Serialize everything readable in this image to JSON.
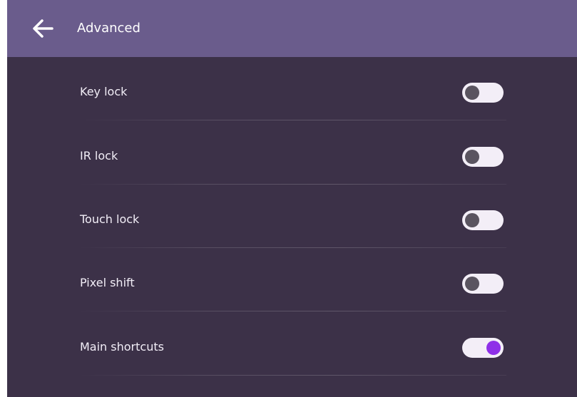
{
  "header": {
    "title": "Advanced",
    "back_icon": "arrow-left-icon"
  },
  "settings": [
    {
      "label": "Key lock",
      "enabled": false
    },
    {
      "label": "IR lock",
      "enabled": false
    },
    {
      "label": "Touch lock",
      "enabled": false
    },
    {
      "label": "Pixel shift",
      "enabled": false
    },
    {
      "label": "Main shortcuts",
      "enabled": true
    }
  ],
  "colors": {
    "header_bg": "#6a5c8c",
    "content_bg": "#3c3148",
    "toggle_track": "#f3eef7",
    "toggle_knob_off": "#5a5460",
    "toggle_knob_on": "#8e2fe8"
  }
}
